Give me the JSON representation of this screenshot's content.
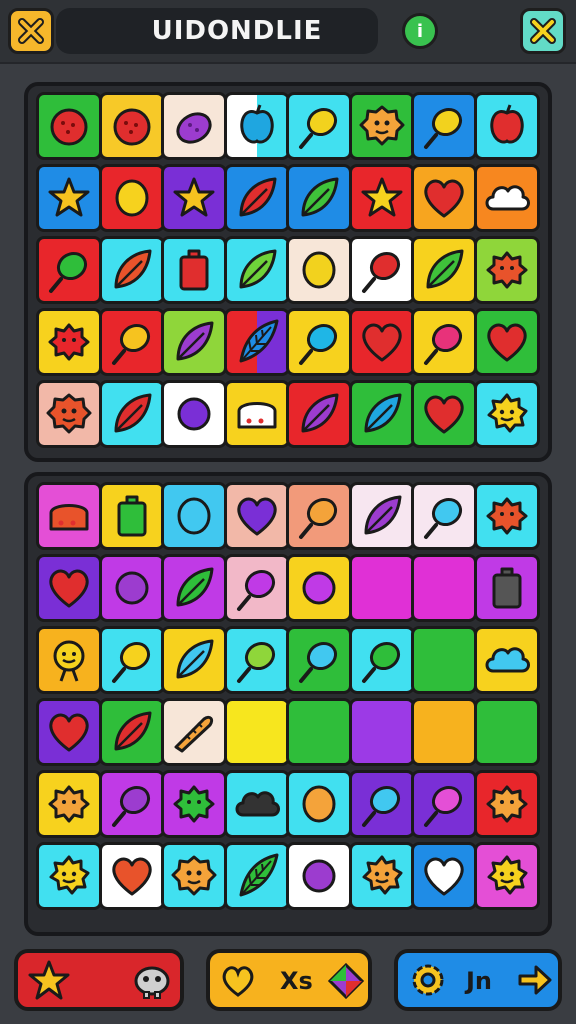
{
  "header": {
    "title": "UIDONDLIE",
    "info_label": "i",
    "left_button_icon": "close-icon",
    "right_button_icon": "close-icon",
    "left_button_color": "#f6b72b",
    "right_button_color": "#62dbc7"
  },
  "boards": [
    {
      "name": "upper-board",
      "rows": [
        [
          {
            "bg": "#2fbe3a",
            "icon": "berry-icon",
            "fill": "#e02e2e"
          },
          {
            "bg": "#f7c928",
            "icon": "berry-icon",
            "fill": "#e02e2e"
          },
          {
            "bg": "#f7e6d8",
            "icon": "grape-icon",
            "fill": "#9c3ccf"
          },
          {
            "bg": "#ffffff",
            "icon": "apple-icon",
            "fill": "#1fa6e0",
            "bg2": "#41e0f0"
          },
          {
            "bg": "#41e0f0",
            "icon": "lollipop-icon",
            "fill": "#f2d21e"
          },
          {
            "bg": "#2fbe3a",
            "icon": "cookie-icon",
            "fill": "#f4a33a"
          },
          {
            "bg": "#1f8ce6",
            "icon": "lollipop-icon",
            "fill": "#f2d21e"
          },
          {
            "bg": "#41e0f0",
            "icon": "apple-icon",
            "fill": "#e02e2e"
          }
        ],
        [
          {
            "bg": "#1f8ce6",
            "icon": "star-icon",
            "fill": "#f6c31f"
          },
          {
            "bg": "#e8262b",
            "icon": "lemon-icon",
            "fill": "#f6d21e"
          },
          {
            "bg": "#7a2fd6",
            "icon": "star-icon",
            "fill": "#f6c31f"
          },
          {
            "bg": "#1f8ce6",
            "icon": "leaf-icon",
            "fill": "#e02e2e"
          },
          {
            "bg": "#1f8ce6",
            "icon": "leaf-icon",
            "fill": "#3fc23a"
          },
          {
            "bg": "#e8262b",
            "icon": "star-icon",
            "fill": "#f6d21e"
          },
          {
            "bg": "#f7a51f",
            "icon": "heart-icon",
            "fill": "#e02e2e"
          },
          {
            "bg": "#f7871f",
            "icon": "cloud-icon",
            "fill": "#ffffff"
          }
        ],
        [
          {
            "bg": "#e8262b",
            "icon": "lollipop-icon",
            "fill": "#2fbe3a"
          },
          {
            "bg": "#41e0f0",
            "icon": "leaf-icon",
            "fill": "#e8532b"
          },
          {
            "bg": "#41e0f0",
            "icon": "battery-icon",
            "fill": "#e02e2e"
          },
          {
            "bg": "#41e0f0",
            "icon": "leaf-icon",
            "fill": "#6fd23a"
          },
          {
            "bg": "#f7e6d8",
            "icon": "lemon-icon",
            "fill": "#f2d21e"
          },
          {
            "bg": "#ffffff",
            "icon": "lollipop-icon",
            "fill": "#e02e2e"
          },
          {
            "bg": "#f7d21e",
            "icon": "leaf-icon",
            "fill": "#3fc23a"
          },
          {
            "bg": "#8fd63a",
            "icon": "flower-icon",
            "fill": "#e8532b"
          }
        ],
        [
          {
            "bg": "#f7d21e",
            "icon": "flower-icon",
            "fill": "#e8262b"
          },
          {
            "bg": "#e8262b",
            "icon": "lollipop-icon",
            "fill": "#f6c31f"
          },
          {
            "bg": "#8fd63a",
            "icon": "leaf-icon",
            "fill": "#9c3ccf"
          },
          {
            "bg": "#e8262b",
            "icon": "feather-icon",
            "fill": "#1f8ce6",
            "bg2": "#7a2fd6"
          },
          {
            "bg": "#f7d21e",
            "icon": "lollipop-icon",
            "fill": "#1fb6e6"
          },
          {
            "bg": "#e8262b",
            "icon": "heart-icon",
            "fill": "#e02e2e"
          },
          {
            "bg": "#f7d21e",
            "icon": "lollipop-icon",
            "fill": "#e8327a"
          },
          {
            "bg": "#2fbe3a",
            "icon": "heart-icon",
            "fill": "#e02e2e"
          }
        ],
        [
          {
            "bg": "#f2b8a8",
            "icon": "cookie-icon",
            "fill": "#e8532b"
          },
          {
            "bg": "#41e0f0",
            "icon": "leaf-icon",
            "fill": "#e02e2e"
          },
          {
            "bg": "#ffffff",
            "icon": "orb-icon",
            "fill": "#7a2fd6"
          },
          {
            "bg": "#f7d21e",
            "icon": "cake-icon",
            "fill": "#ffffff"
          },
          {
            "bg": "#e8262b",
            "icon": "leaf-icon",
            "fill": "#9c3ccf"
          },
          {
            "bg": "#2fbe3a",
            "icon": "leaf-icon",
            "fill": "#1fa6e0"
          },
          {
            "bg": "#2fbe3a",
            "icon": "heart-icon",
            "fill": "#e02e2e"
          },
          {
            "bg": "#41e0f0",
            "icon": "sun-icon",
            "fill": "#f6d21e"
          }
        ]
      ]
    },
    {
      "name": "lower-board",
      "rows": [
        [
          {
            "bg": "#e44fd6",
            "icon": "cake-icon",
            "fill": "#e8532b"
          },
          {
            "bg": "#f7d21e",
            "icon": "battery-icon",
            "fill": "#2fbe3a"
          },
          {
            "bg": "#41c8f0",
            "icon": "lemon-icon",
            "fill": "#41c8f0"
          },
          {
            "bg": "#f2b8a8",
            "icon": "heart-icon",
            "fill": "#7a2fd6"
          },
          {
            "bg": "#f29a7a",
            "icon": "lollipop-icon",
            "fill": "#f4a33a"
          },
          {
            "bg": "#f7e6f0",
            "icon": "leaf-icon",
            "fill": "#9c3ccf"
          },
          {
            "bg": "#f7e6f0",
            "icon": "lollipop-icon",
            "fill": "#41c8f0"
          },
          {
            "bg": "#41e0f0",
            "icon": "flower-icon",
            "fill": "#e8532b"
          }
        ],
        [
          {
            "bg": "#7a2fd6",
            "icon": "heart-icon",
            "fill": "#e02e2e"
          },
          {
            "bg": "#c03ae6",
            "icon": "orb-icon",
            "fill": "#9c3ccf"
          },
          {
            "bg": "#c03ae6",
            "icon": "leaf-icon",
            "fill": "#2fbe3a"
          },
          {
            "bg": "#f2b8c8",
            "icon": "lollipop-icon",
            "fill": "#c03ae6"
          },
          {
            "bg": "#f7d21e",
            "icon": "orb-icon",
            "fill": "#c03ae6"
          },
          {
            "bg": "#e030d6",
            "icon": "none",
            "fill": "#e030d6"
          },
          {
            "bg": "#e030d6",
            "icon": "none",
            "fill": "#e030d6"
          },
          {
            "bg": "#c03ae6",
            "icon": "battery-icon",
            "fill": "#555555"
          }
        ],
        [
          {
            "bg": "#f7b21e",
            "icon": "face-icon",
            "fill": "#f6d21e"
          },
          {
            "bg": "#41e0f0",
            "icon": "lollipop-icon",
            "fill": "#f6d21e"
          },
          {
            "bg": "#f7d21e",
            "icon": "leaf-icon",
            "fill": "#41c8f0"
          },
          {
            "bg": "#41e0f0",
            "icon": "lollipop-icon",
            "fill": "#8fd63a"
          },
          {
            "bg": "#2fbe3a",
            "icon": "lollipop-icon",
            "fill": "#41c8f0"
          },
          {
            "bg": "#41e0f0",
            "icon": "lollipop-icon",
            "fill": "#2fbe3a"
          },
          {
            "bg": "#2fbe3a",
            "icon": "none",
            "fill": "#2fbe3a"
          },
          {
            "bg": "#f7d21e",
            "icon": "cloud-icon",
            "fill": "#41c8f0"
          }
        ],
        [
          {
            "bg": "#7a2fd6",
            "icon": "heart-icon",
            "fill": "#e02e2e"
          },
          {
            "bg": "#2fbe3a",
            "icon": "leaf-icon",
            "fill": "#e02e2e"
          },
          {
            "bg": "#f7e6d8",
            "icon": "carrot-icon",
            "fill": "#f4a33a"
          },
          {
            "bg": "#f7e61e",
            "icon": "none",
            "fill": "#f7e61e"
          },
          {
            "bg": "#2fbe3a",
            "icon": "none",
            "fill": "#2fbe3a"
          },
          {
            "bg": "#9c3ae6",
            "icon": "none",
            "fill": "#9c3ae6"
          },
          {
            "bg": "#f7b21e",
            "icon": "none",
            "fill": "#f7b21e"
          },
          {
            "bg": "#2fbe3a",
            "icon": "none",
            "fill": "#2fbe3a"
          }
        ],
        [
          {
            "bg": "#f7d21e",
            "icon": "flower-icon",
            "fill": "#f4a33a"
          },
          {
            "bg": "#c03ae6",
            "icon": "lollipop-icon",
            "fill": "#9c3ccf"
          },
          {
            "bg": "#c03ae6",
            "icon": "flower-icon",
            "fill": "#2fbe3a"
          },
          {
            "bg": "#41e0f0",
            "icon": "cloud-icon",
            "fill": "#333333"
          },
          {
            "bg": "#41e0f0",
            "icon": "lemon-icon",
            "fill": "#f4a33a"
          },
          {
            "bg": "#7a2fd6",
            "icon": "lollipop-icon",
            "fill": "#41c8f0"
          },
          {
            "bg": "#7a2fd6",
            "icon": "lollipop-icon",
            "fill": "#e44fd6"
          },
          {
            "bg": "#e8262b",
            "icon": "flower-icon",
            "fill": "#f4a33a"
          }
        ],
        [
          {
            "bg": "#41e0f0",
            "icon": "sun-icon",
            "fill": "#f6d21e"
          },
          {
            "bg": "#ffffff",
            "icon": "heart-icon",
            "fill": "#e8532b"
          },
          {
            "bg": "#41e0f0",
            "icon": "cookie-icon",
            "fill": "#f4a33a"
          },
          {
            "bg": "#41e0f0",
            "icon": "feather-icon",
            "fill": "#2fbe3a"
          },
          {
            "bg": "#ffffff",
            "icon": "orb-icon",
            "fill": "#9c3ccf"
          },
          {
            "bg": "#41e0f0",
            "icon": "sun-icon",
            "fill": "#f4a33a"
          },
          {
            "bg": "#1f8ce6",
            "icon": "heart-icon",
            "fill": "#ffffff"
          },
          {
            "bg": "#e44fd6",
            "icon": "sun-icon",
            "fill": "#f6d21e"
          }
        ]
      ]
    }
  ],
  "bottom_bar": {
    "left_button": {
      "color": "#d9262b",
      "icon": "star-icon",
      "icon2": "creature-icon"
    },
    "middle_button": {
      "color": "#f7b21e",
      "icon": "heart-icon",
      "label": "Xs",
      "icon2": "diamond-icon"
    },
    "right_button": {
      "color": "#1f8ce6",
      "icon": "gear-icon",
      "label": "Jn",
      "icon2": "arrow-right-icon"
    }
  }
}
